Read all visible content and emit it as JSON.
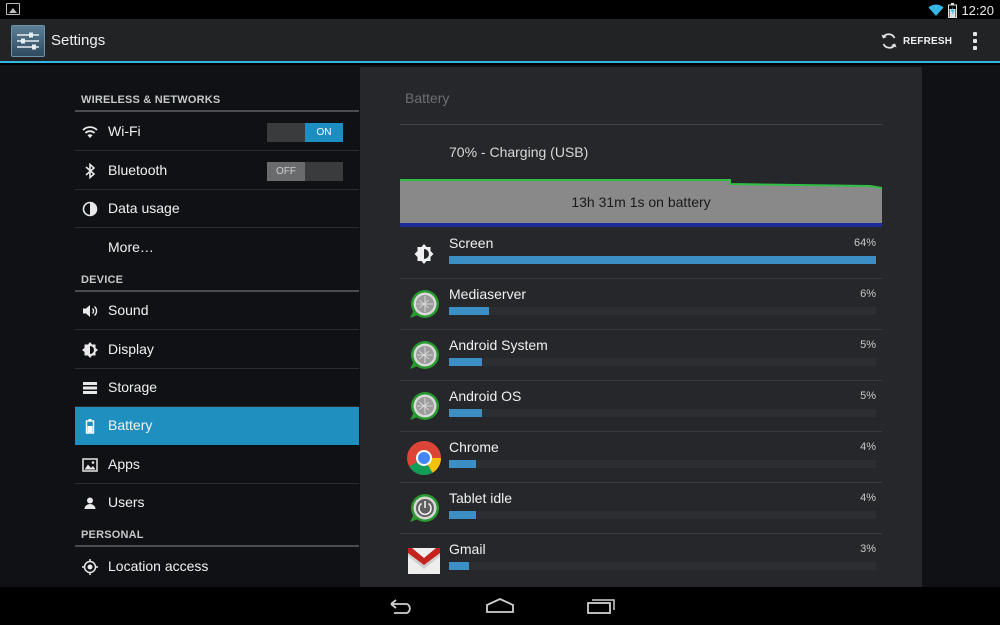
{
  "status_bar": {
    "time": "12:20"
  },
  "app_bar": {
    "title": "Settings",
    "refresh_label": "REFRESH"
  },
  "sections": [
    {
      "label": "WIRELESS & NETWORKS"
    },
    {
      "label": "DEVICE"
    },
    {
      "label": "PERSONAL"
    }
  ],
  "nav_items": [
    {
      "label": "Wi-Fi",
      "icon": "wifi-icon",
      "toggle": "ON"
    },
    {
      "label": "Bluetooth",
      "icon": "bluetooth-icon",
      "toggle": "OFF"
    },
    {
      "label": "Data usage",
      "icon": "data-usage-icon"
    },
    {
      "label": "More…"
    },
    {
      "label": "Sound",
      "icon": "speaker-icon"
    },
    {
      "label": "Display",
      "icon": "brightness-icon"
    },
    {
      "label": "Storage",
      "icon": "storage-icon"
    },
    {
      "label": "Battery",
      "icon": "battery-icon",
      "selected": true
    },
    {
      "label": "Apps",
      "icon": "apps-icon"
    },
    {
      "label": "Users",
      "icon": "user-icon"
    },
    {
      "label": "Location access",
      "icon": "location-icon"
    }
  ],
  "battery": {
    "title": "Battery",
    "status": "70% - Charging (USB)",
    "graph_label": "13h 31m 1s on battery",
    "usage": [
      {
        "name": "Screen",
        "percent_label": "64%",
        "percent": 64,
        "icon": "brightness-icon"
      },
      {
        "name": "Mediaserver",
        "percent_label": "6%",
        "percent": 6,
        "icon": "android-process-icon"
      },
      {
        "name": "Android System",
        "percent_label": "5%",
        "percent": 5,
        "icon": "android-process-icon"
      },
      {
        "name": "Android OS",
        "percent_label": "5%",
        "percent": 5,
        "icon": "android-process-icon"
      },
      {
        "name": "Chrome",
        "percent_label": "4%",
        "percent": 4,
        "icon": "chrome-icon"
      },
      {
        "name": "Tablet idle",
        "percent_label": "4%",
        "percent": 4,
        "icon": "power-idle-icon"
      },
      {
        "name": "Gmail",
        "percent_label": "3%",
        "percent": 3,
        "icon": "gmail-icon"
      }
    ]
  },
  "colors": {
    "accent": "#33b5e5",
    "selected": "#1f8fc0",
    "bar": "#3c8fc4"
  }
}
